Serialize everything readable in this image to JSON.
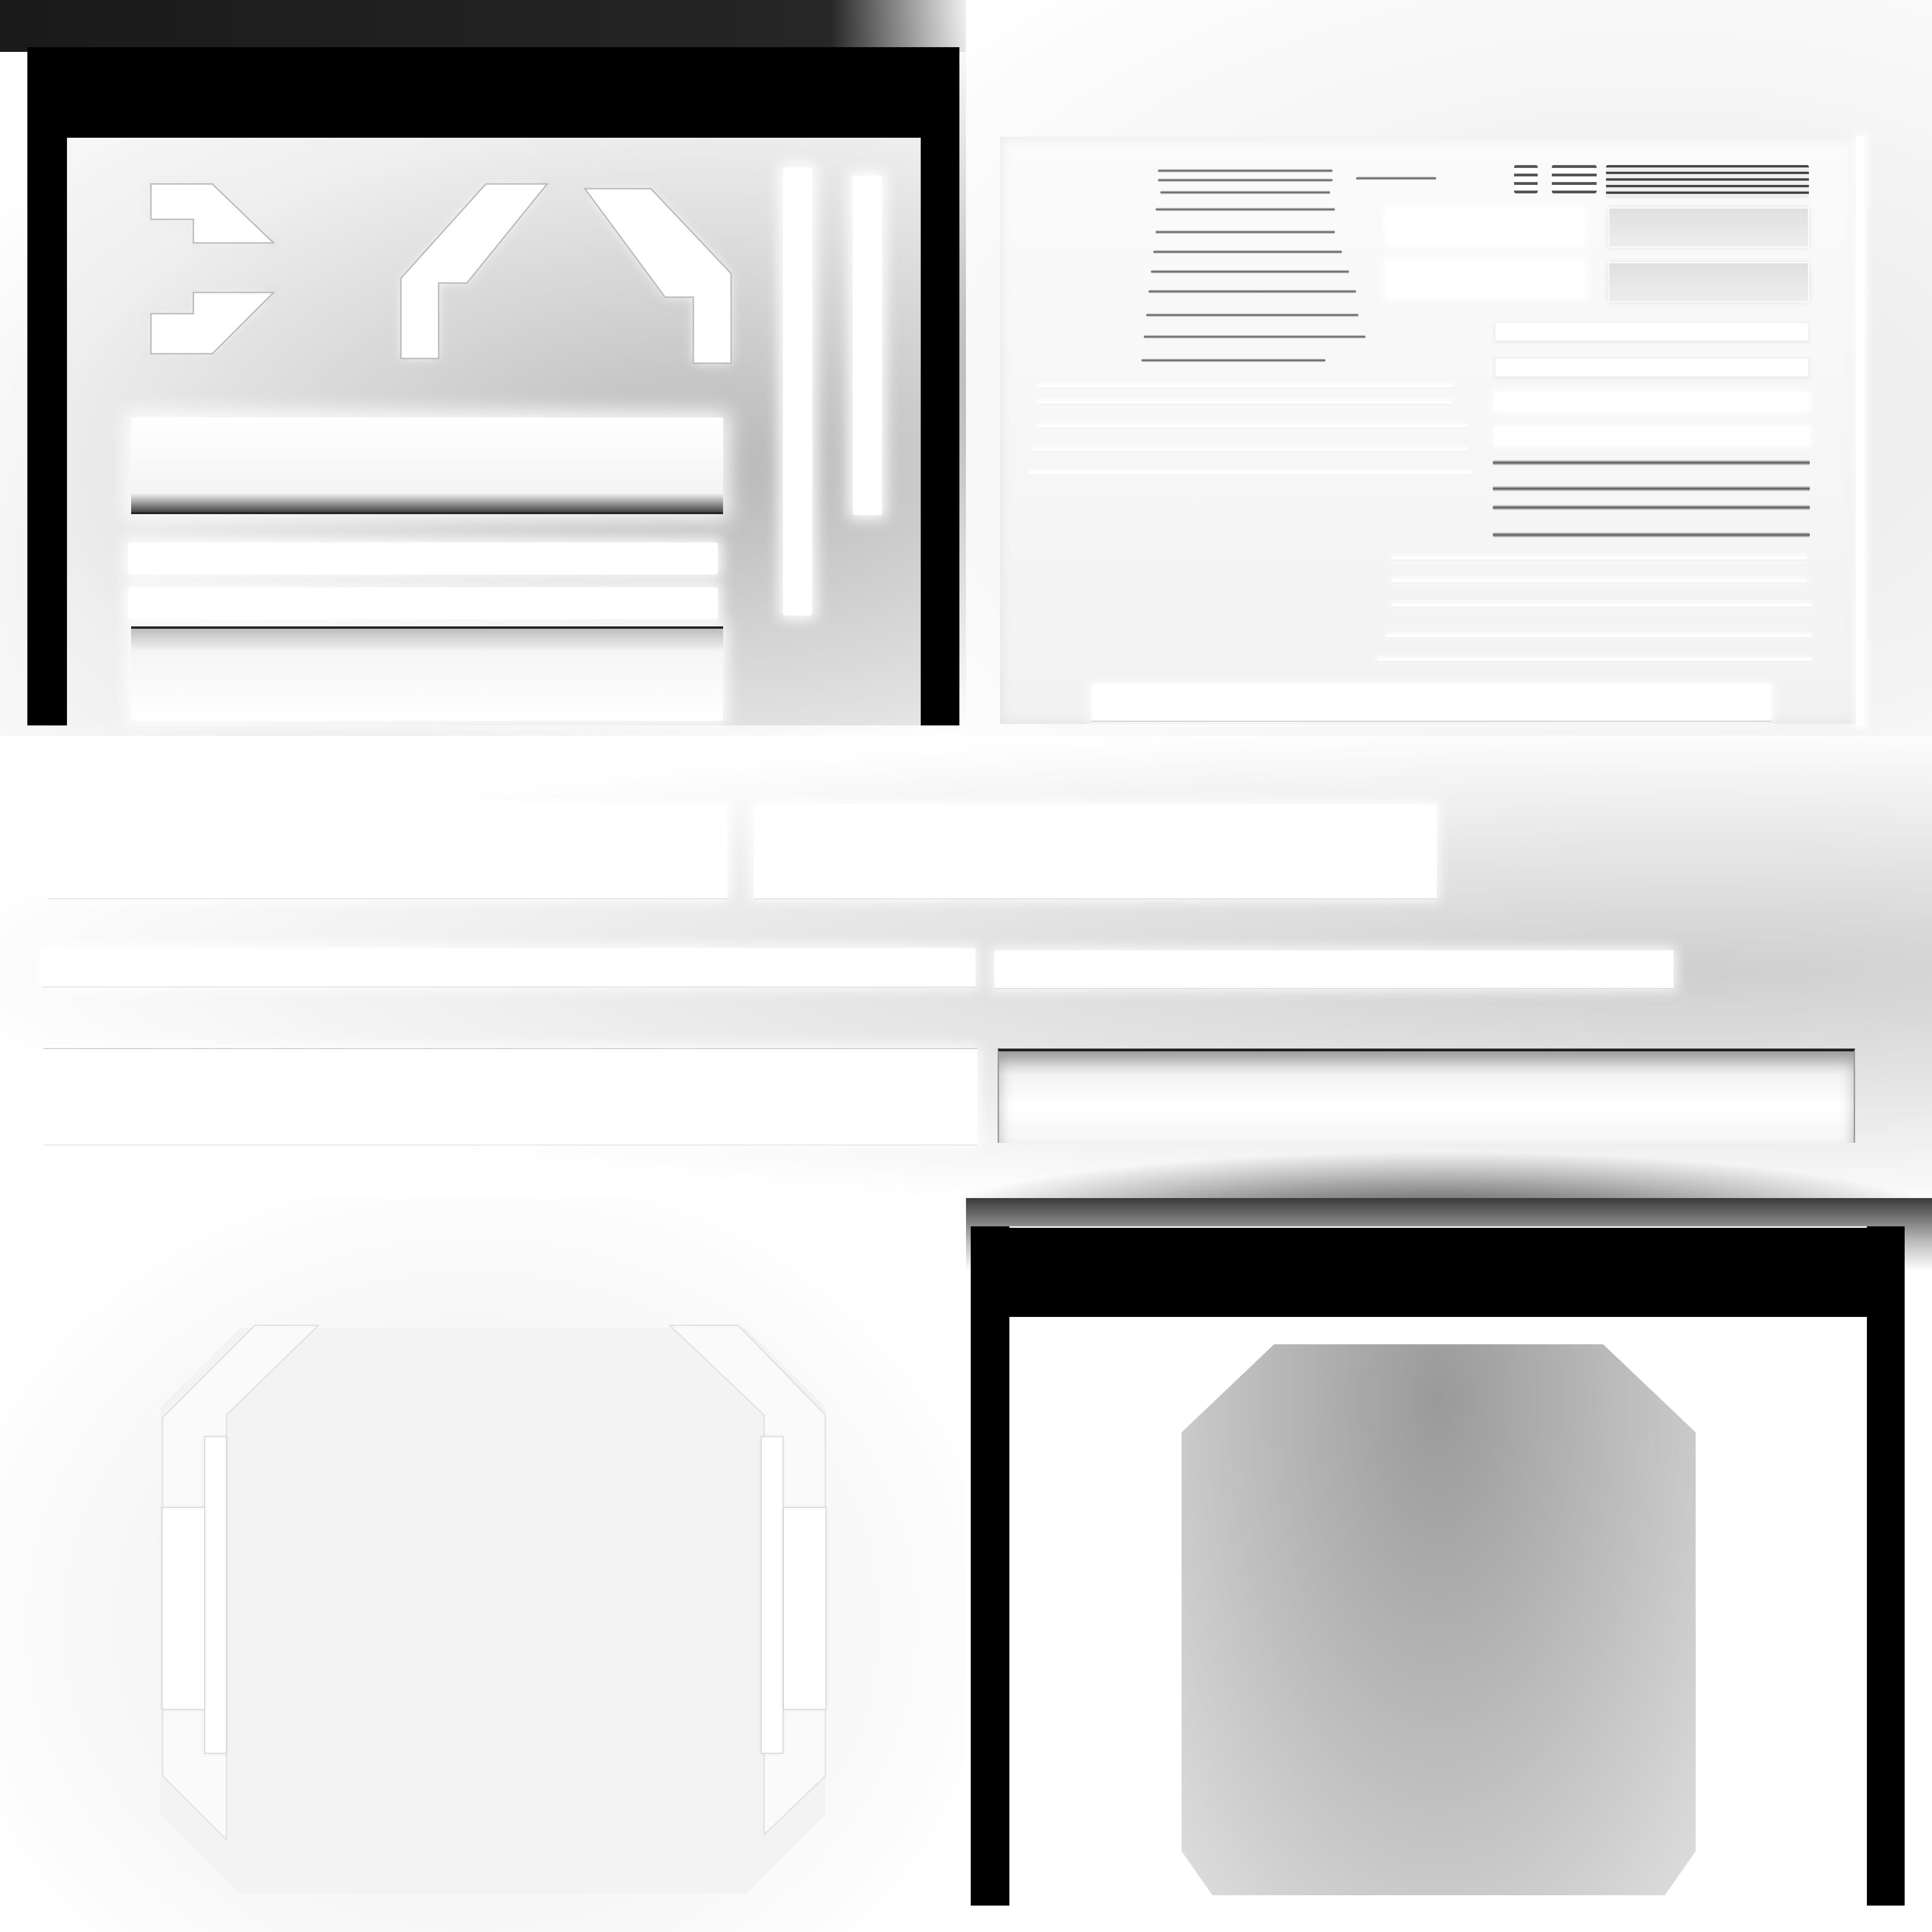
{
  "texture": {
    "quadrants": [
      {
        "id": "top-left",
        "frame_color": "#000000",
        "background": "#d6d6d6",
        "highlight": "#ffffff"
      },
      {
        "id": "top-right",
        "background": "#f4f4f4",
        "detail_color": "#555555"
      },
      {
        "id": "bottom-left",
        "background": "#f3f3f3",
        "bracket_color": "#ffffff"
      },
      {
        "id": "bottom-right",
        "frame_color": "#000000",
        "panel_color": "#b8b8b8"
      }
    ],
    "text": []
  }
}
